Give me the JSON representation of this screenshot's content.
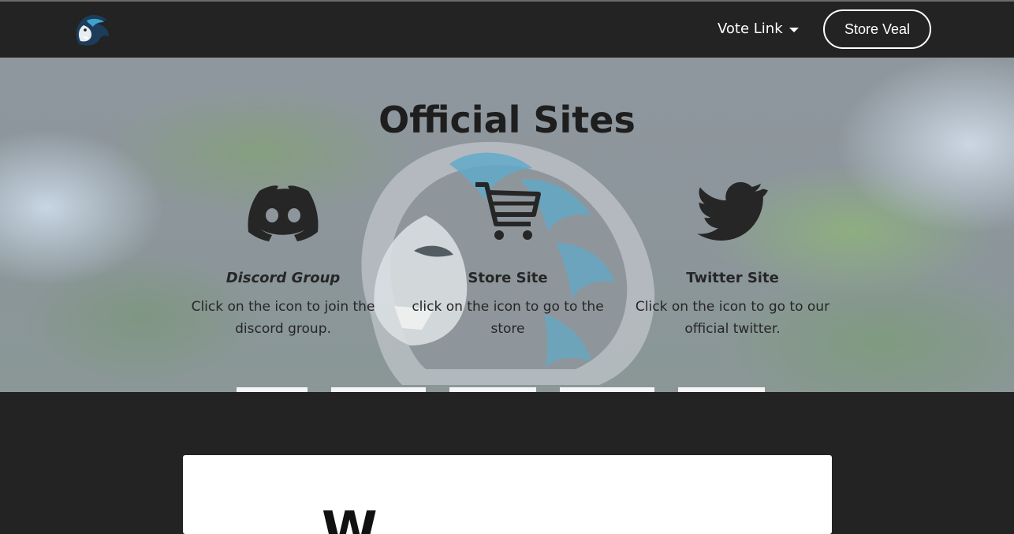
{
  "nav": {
    "logo_icon": "lion-head-logo-icon",
    "vote_link_label": "Vote Link",
    "store_button_label": "Store Veal"
  },
  "hero": {
    "title": "Official Sites",
    "sites": [
      {
        "icon": "discord-icon",
        "title": "Discord Group",
        "description": "Click on the icon to join the discord group."
      },
      {
        "icon": "shopping-cart-icon",
        "title": "Store Site",
        "description": "click on the icon to go to the store"
      },
      {
        "icon": "twitter-bird-icon",
        "title": "Twitter Site",
        "description": "Click on the icon to go to our official twitter."
      }
    ]
  },
  "card": {
    "heading_partial": "W"
  },
  "colors": {
    "navbar": "#232323",
    "page_background": "#232323",
    "text_dark": "#262626",
    "card_background": "#ffffff",
    "lion_accent": "#5aaed0"
  }
}
